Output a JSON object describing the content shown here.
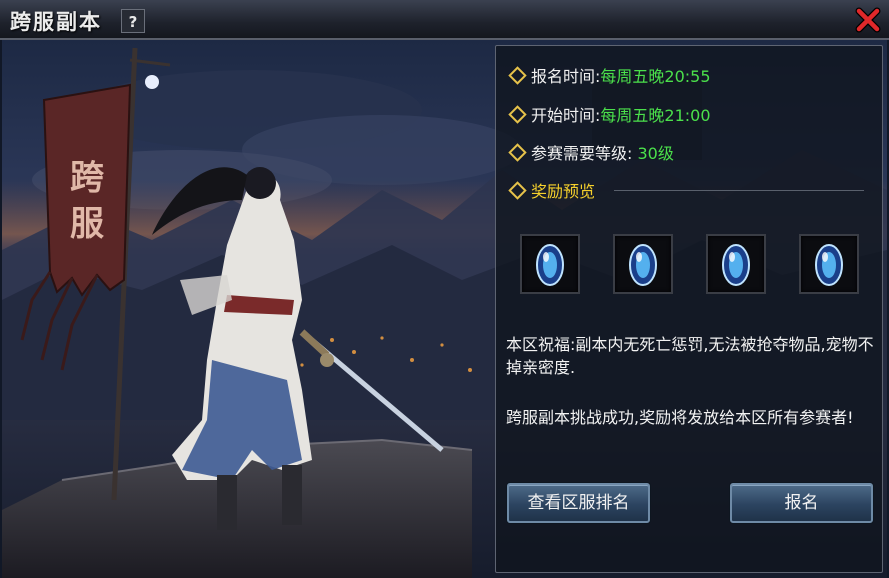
{
  "window": {
    "title": "跨服副本",
    "help_label": "?"
  },
  "banner": {
    "text": "跨服"
  },
  "info": {
    "signup_label": "报名时间:",
    "signup_value": "每周五晚20:55",
    "start_label": "开始时间:",
    "start_value": "每周五晚21:00",
    "level_label": "参赛需要等级:",
    "level_value": "30级",
    "reward_label": "奖励预览"
  },
  "rewards": [
    {
      "icon": "blue-gem-icon"
    },
    {
      "icon": "blue-gem-icon"
    },
    {
      "icon": "blue-gem-icon"
    },
    {
      "icon": "blue-gem-icon"
    }
  ],
  "description": {
    "blessing": "本区祝福:副本内无死亡惩罚,无法被抢夺物品,宠物不掉亲密度.",
    "success": "跨服副本挑战成功,奖励将发放给本区所有参赛者!"
  },
  "buttons": {
    "ranking": "查看区服排名",
    "signup": "报名"
  },
  "colors": {
    "highlight_green": "#4be04b",
    "highlight_gold": "#f5d02c",
    "close_red": "#e0282a"
  }
}
